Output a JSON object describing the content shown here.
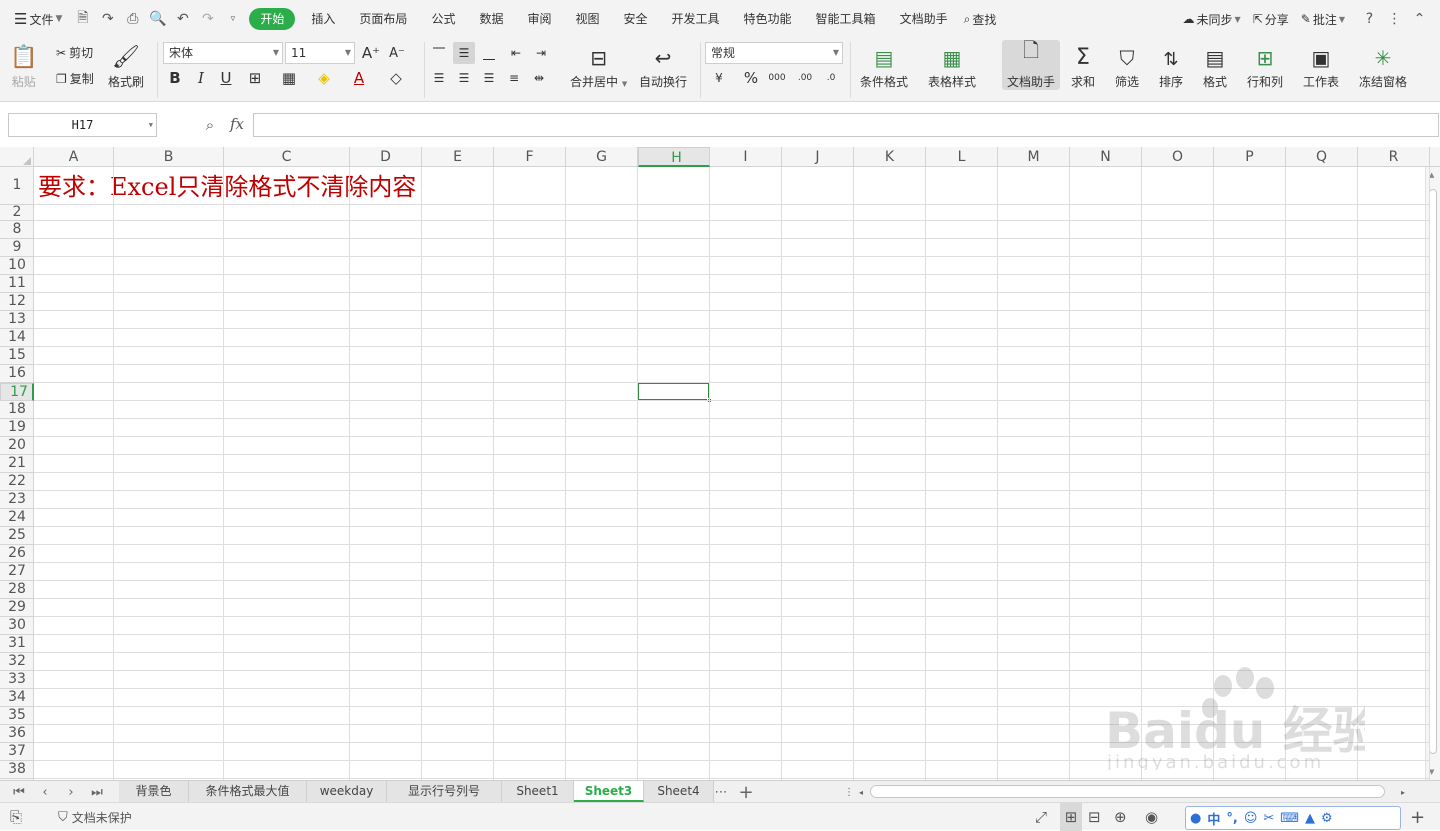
{
  "menubar": {
    "file": "文件",
    "tabs": [
      "开始",
      "插入",
      "页面布局",
      "公式",
      "数据",
      "审阅",
      "视图",
      "安全",
      "开发工具",
      "特色功能",
      "智能工具箱",
      "文档助手"
    ],
    "search": "查找",
    "right": {
      "sync": "未同步",
      "share": "分享",
      "annotate": "批注"
    }
  },
  "ribbon": {
    "paste": "粘贴",
    "cut": "剪切",
    "copy": "复制",
    "format_painter": "格式刷",
    "font_name": "宋体",
    "font_size": "11",
    "merge_center": "合并居中",
    "wrap_text": "自动换行",
    "number_format": "常规",
    "conditional_format": "条件格式",
    "table_style": "表格样式",
    "doc_assistant": "文档助手",
    "sum": "求和",
    "filter": "筛选",
    "sort": "排序",
    "format": "格式",
    "rows_cols": "行和列",
    "worksheet": "工作表",
    "freeze": "冻结窗格"
  },
  "formula_bar": {
    "name_box": "H17",
    "fx": "fx",
    "content": ""
  },
  "sheet": {
    "columns": [
      "A",
      "B",
      "C",
      "D",
      "E",
      "F",
      "G",
      "H",
      "I",
      "J",
      "K",
      "L",
      "M",
      "N",
      "O",
      "P",
      "Q",
      "R"
    ],
    "rows": [
      "1",
      "2",
      "8",
      "9",
      "10",
      "11",
      "12",
      "13",
      "14",
      "15",
      "16",
      "17",
      "18",
      "19",
      "20",
      "21",
      "22",
      "23",
      "24",
      "25",
      "26",
      "27",
      "28",
      "29",
      "30",
      "31",
      "32",
      "33",
      "34",
      "35",
      "36",
      "37",
      "38"
    ],
    "selected_column": "H",
    "selected_row": "17",
    "cell_a1": "要求：Excel只清除格式不清除内容",
    "cell_a1_color": "#c00000"
  },
  "sheet_tabs": {
    "tabs": [
      "背景色",
      "条件格式最大值",
      "weekday",
      "显示行号列号",
      "Sheet1",
      "Sheet3",
      "Sheet4"
    ],
    "active": "Sheet3"
  },
  "statusbar": {
    "protection": "文档未保护",
    "ime_mode": "中"
  },
  "watermark": {
    "brand": "Baidu 经验",
    "url": "jingyan.baidu.com"
  },
  "colors": {
    "accent": "#2bae4a",
    "selection": "#2e8b3e",
    "text_red": "#c00000"
  },
  "icons": [
    "menu-icon",
    "save-icon",
    "print-icon",
    "undo-icon",
    "redo-icon",
    "search-icon",
    "cloud-icon",
    "share-icon",
    "annotate-icon",
    "help-icon",
    "more-icon",
    "collapse-icon"
  ]
}
